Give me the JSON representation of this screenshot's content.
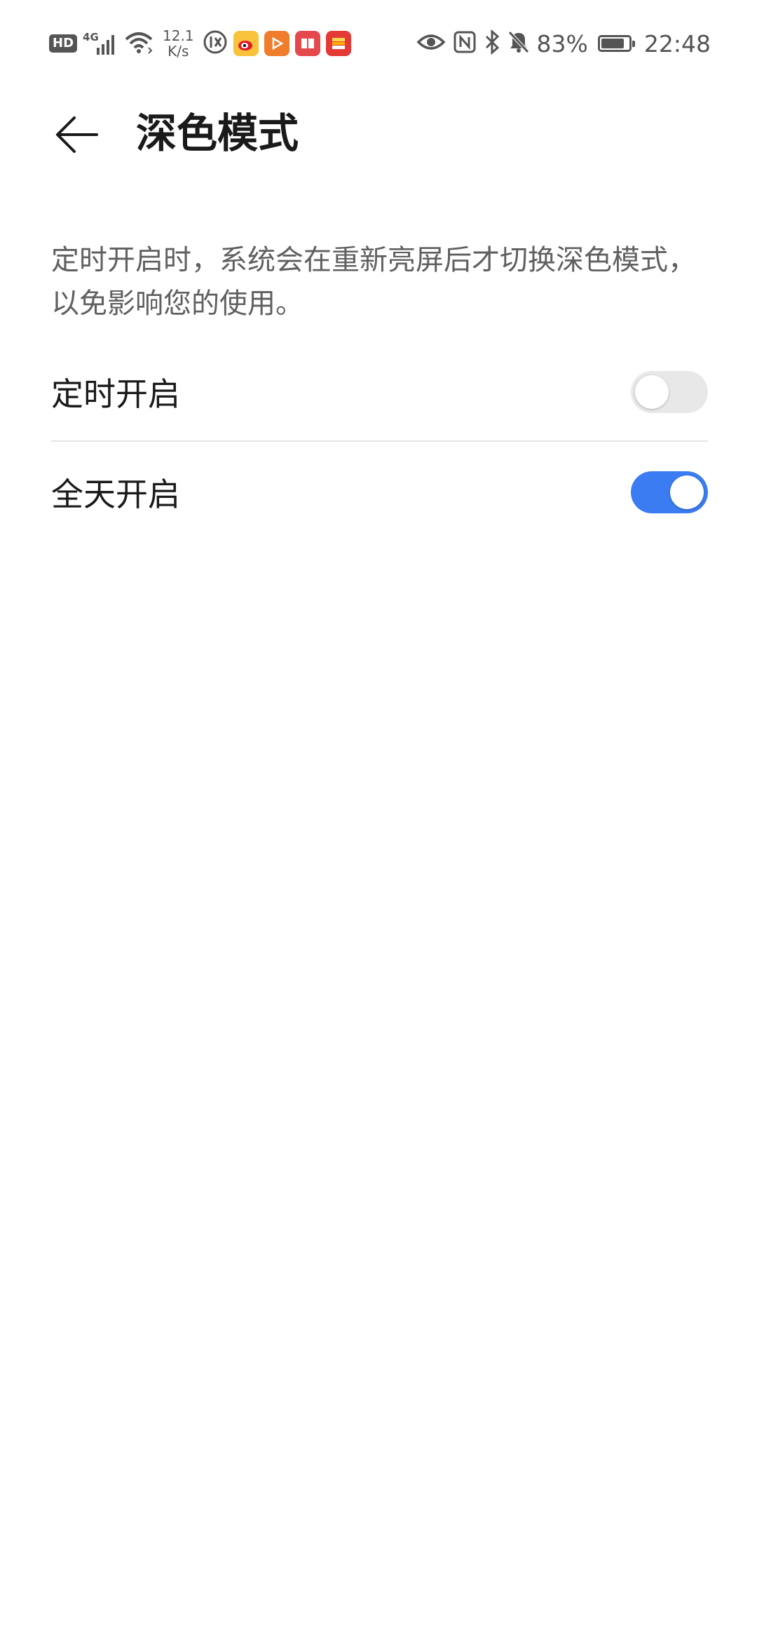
{
  "status_bar": {
    "hd_label": "HD",
    "network_label": "4G",
    "net_speed_value": "12.1",
    "net_speed_unit": "K/s",
    "battery_percent_text": "83%",
    "battery_level": 0.83,
    "time": "22:48",
    "notification_icons": [
      "data-saver-icon",
      "weibo-icon",
      "video-app-icon",
      "reader-app-icon",
      "wallet-app-icon"
    ],
    "system_icons": [
      "eye-comfort-icon",
      "nfc-icon",
      "bluetooth-icon",
      "bell-muted-icon"
    ]
  },
  "app_bar": {
    "title": "深色模式"
  },
  "description": "定时开启时，系统会在重新亮屏后才切换深色模式，以免影响您的使用。",
  "settings": [
    {
      "label": "定时开启",
      "enabled": false
    },
    {
      "label": "全天开启",
      "enabled": true
    }
  ],
  "colors": {
    "accent": "#3b7cf2",
    "switch_off": "#e8e8e8",
    "title": "#1a1a1a",
    "secondary_text": "#606060"
  }
}
